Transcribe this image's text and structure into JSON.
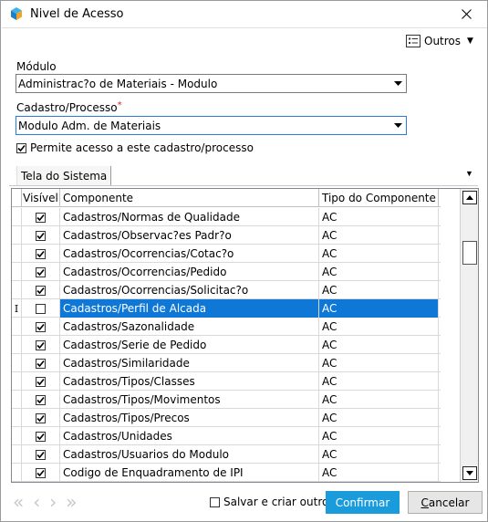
{
  "window": {
    "title": "Nivel de Acesso",
    "close_icon": "close-icon"
  },
  "toolbar": {
    "outros_label": "Outros"
  },
  "form": {
    "modulo_label": "Módulo",
    "modulo_value": "Administrac?o de Materiais - Modulo",
    "cadastro_label": "Cadastro/Processo",
    "required_mark": "*",
    "cadastro_value": "Modulo Adm. de Materiais",
    "permite_label": "Permite acesso a este cadastro/processo",
    "permite_checked": true
  },
  "tabs": [
    {
      "label": "Tela do Sistema"
    }
  ],
  "grid": {
    "columns": [
      "Visível",
      "Componente",
      "Tipo do Componente"
    ],
    "rows": [
      {
        "indicator": "",
        "visible": true,
        "componente": "Cadastros/Normas de Qualidade",
        "tipo": "AC"
      },
      {
        "indicator": "",
        "visible": true,
        "componente": "Cadastros/Observac?es Padr?o",
        "tipo": "AC"
      },
      {
        "indicator": "",
        "visible": true,
        "componente": "Cadastros/Ocorrencias/Cotac?o",
        "tipo": "AC"
      },
      {
        "indicator": "",
        "visible": true,
        "componente": "Cadastros/Ocorrencias/Pedido",
        "tipo": "AC"
      },
      {
        "indicator": "",
        "visible": true,
        "componente": "Cadastros/Ocorrencias/Solicitac?o",
        "tipo": "AC"
      },
      {
        "indicator": "I",
        "visible": false,
        "componente": "Cadastros/Perfil de Alcada",
        "tipo": "AC",
        "selected": true
      },
      {
        "indicator": "",
        "visible": true,
        "componente": "Cadastros/Sazonalidade",
        "tipo": "AC"
      },
      {
        "indicator": "",
        "visible": true,
        "componente": "Cadastros/Serie de Pedido",
        "tipo": "AC"
      },
      {
        "indicator": "",
        "visible": true,
        "componente": "Cadastros/Similaridade",
        "tipo": "AC"
      },
      {
        "indicator": "",
        "visible": true,
        "componente": "Cadastros/Tipos/Classes",
        "tipo": "AC"
      },
      {
        "indicator": "",
        "visible": true,
        "componente": "Cadastros/Tipos/Movimentos",
        "tipo": "AC"
      },
      {
        "indicator": "",
        "visible": true,
        "componente": "Cadastros/Tipos/Precos",
        "tipo": "AC"
      },
      {
        "indicator": "",
        "visible": true,
        "componente": "Cadastros/Unidades",
        "tipo": "AC"
      },
      {
        "indicator": "",
        "visible": true,
        "componente": "Cadastros/Usuarios do Modulo",
        "tipo": "AC"
      },
      {
        "indicator": "",
        "visible": true,
        "componente": "Codigo de Enquadramento de IPI",
        "tipo": "AC"
      }
    ]
  },
  "footer": {
    "nav_first": "«",
    "nav_prev": "‹",
    "nav_next": "›",
    "nav_last": "»",
    "save_new_label": "Salvar e criar outro",
    "save_new_checked": false,
    "confirm_label": "Confirmar",
    "cancel_label": "Cancelar"
  },
  "colors": {
    "accent": "#1a9bdc",
    "selection": "#0f78d7"
  }
}
